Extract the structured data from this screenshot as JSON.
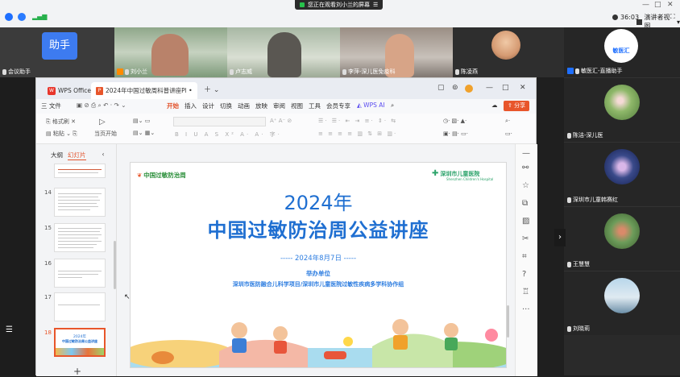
{
  "topbar": {
    "share_notice": "您正在观看刘小兰的屏幕",
    "timer": "36:03",
    "presenter_view": "演讲者视图"
  },
  "videos": [
    {
      "name": "会议助手",
      "avatar_text": "助手"
    },
    {
      "name": "刘小兰"
    },
    {
      "name": "卢志威"
    },
    {
      "name": "李萍-深儿医免疫科"
    },
    {
      "name": "陈凌燕"
    }
  ],
  "right_panel": {
    "host": {
      "name": "敏医汇-直播助手",
      "logo_text": "敏医汇"
    },
    "participants": [
      {
        "name": "陈洁-深儿医"
      },
      {
        "name": "深圳市儿童韩赛红"
      },
      {
        "name": "王慧慧"
      },
      {
        "name": "刘晓莉"
      }
    ]
  },
  "wps": {
    "tabs": {
      "home": "WPS Office",
      "doc": "2024年中国过敏周科普讲座PPT.p"
    },
    "menu": {
      "file": "三 文件",
      "items": [
        "开始",
        "插入",
        "设计",
        "切换",
        "动画",
        "放映",
        "审阅",
        "视图",
        "工具",
        "会员专享"
      ],
      "wps_ai": "WPS AI",
      "share": "分享"
    },
    "ribbon": {
      "format_painter": "格式刷",
      "paste": "粘贴",
      "from_current": "当页开始"
    },
    "thumb_tabs": {
      "outline": "大纲",
      "slides": "幻灯片"
    },
    "thumbnails": [
      {
        "num": "14"
      },
      {
        "num": "15"
      },
      {
        "num": "16"
      },
      {
        "num": "17"
      },
      {
        "num": "18",
        "title": "2024年",
        "subtitle": "中国过敏防治周公益讲座"
      }
    ],
    "add_slide": "+"
  },
  "slide": {
    "logo_left": "中国过敏防治周",
    "logo_right": "深圳市儿童医院",
    "logo_right_sub": "Shenzhen Children's Hospital",
    "year": "2024年",
    "title": "中国过敏防治周公益讲座",
    "date": "----- 2024年8月7日 -----",
    "host_label": "举办单位",
    "host": "深圳市医防融合儿科学项目/深圳市儿童医院过敏性疾病多学科协作组"
  },
  "colors": {
    "accent": "#e8562b",
    "title_blue": "#1f6fd1"
  }
}
